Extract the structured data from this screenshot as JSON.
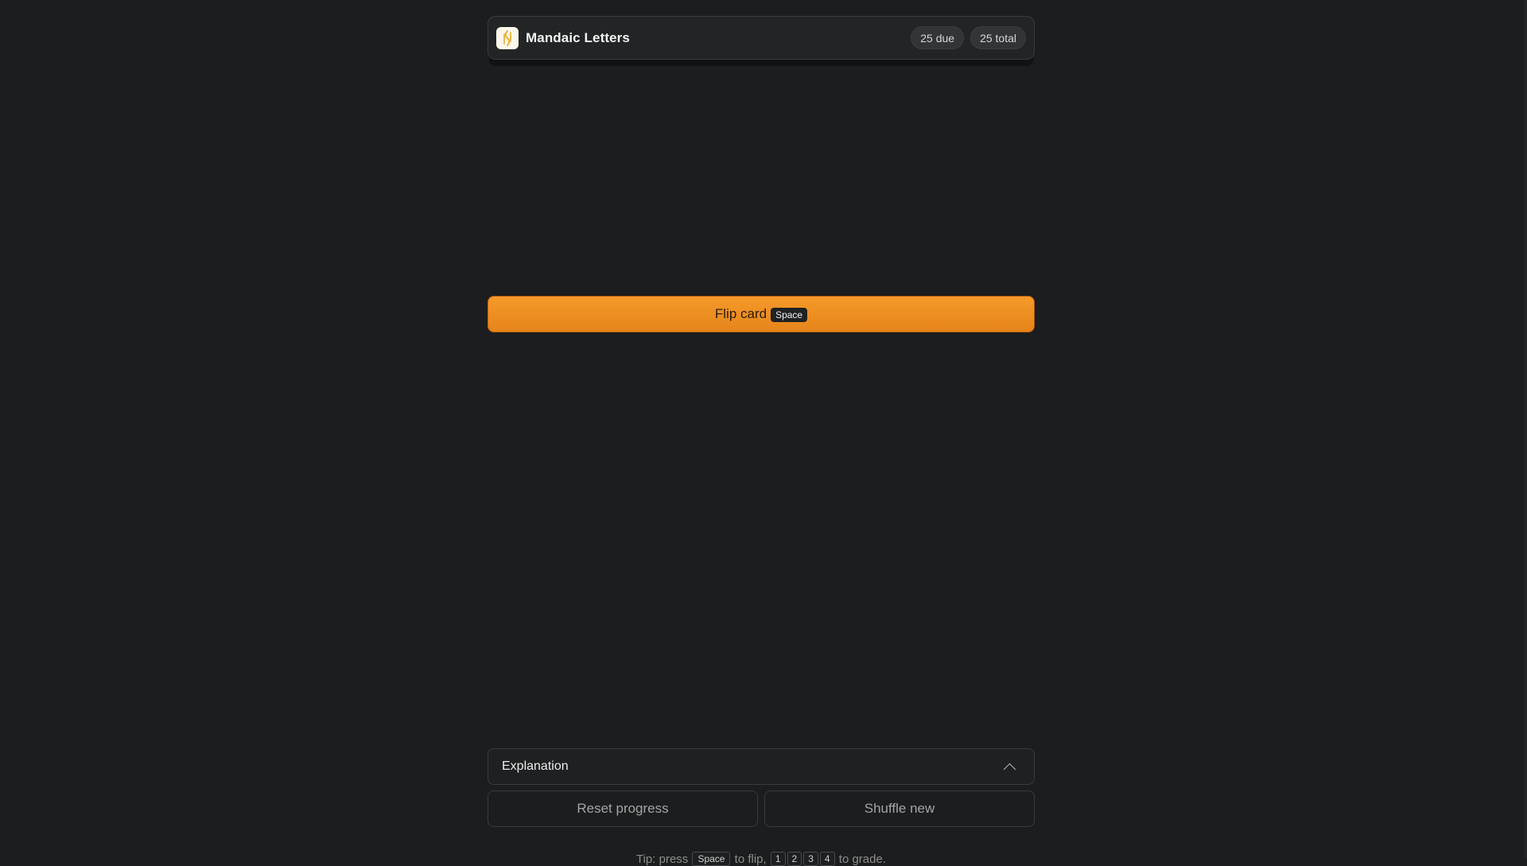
{
  "header": {
    "title": "Mandaic Letters",
    "icon": "mandaic-glyph-icon",
    "due_label": "25 due",
    "total_label": "25 total"
  },
  "flip": {
    "label": "Flip card",
    "shortcut": "Space"
  },
  "explanation": {
    "label": "Explanation",
    "icon": "chevron-up-icon"
  },
  "actions": {
    "reset_label": "Reset progress",
    "shuffle_label": "Shuffle new"
  },
  "tip": {
    "prefix": "Tip: press",
    "flip_key": "Space",
    "middle": "to flip,",
    "grade_keys": [
      "1",
      "2",
      "3",
      "4"
    ],
    "suffix": "to grade."
  },
  "colors": {
    "background": "#1c1d1e",
    "accent": "#f59a2a",
    "accent_border": "#b8600f"
  }
}
